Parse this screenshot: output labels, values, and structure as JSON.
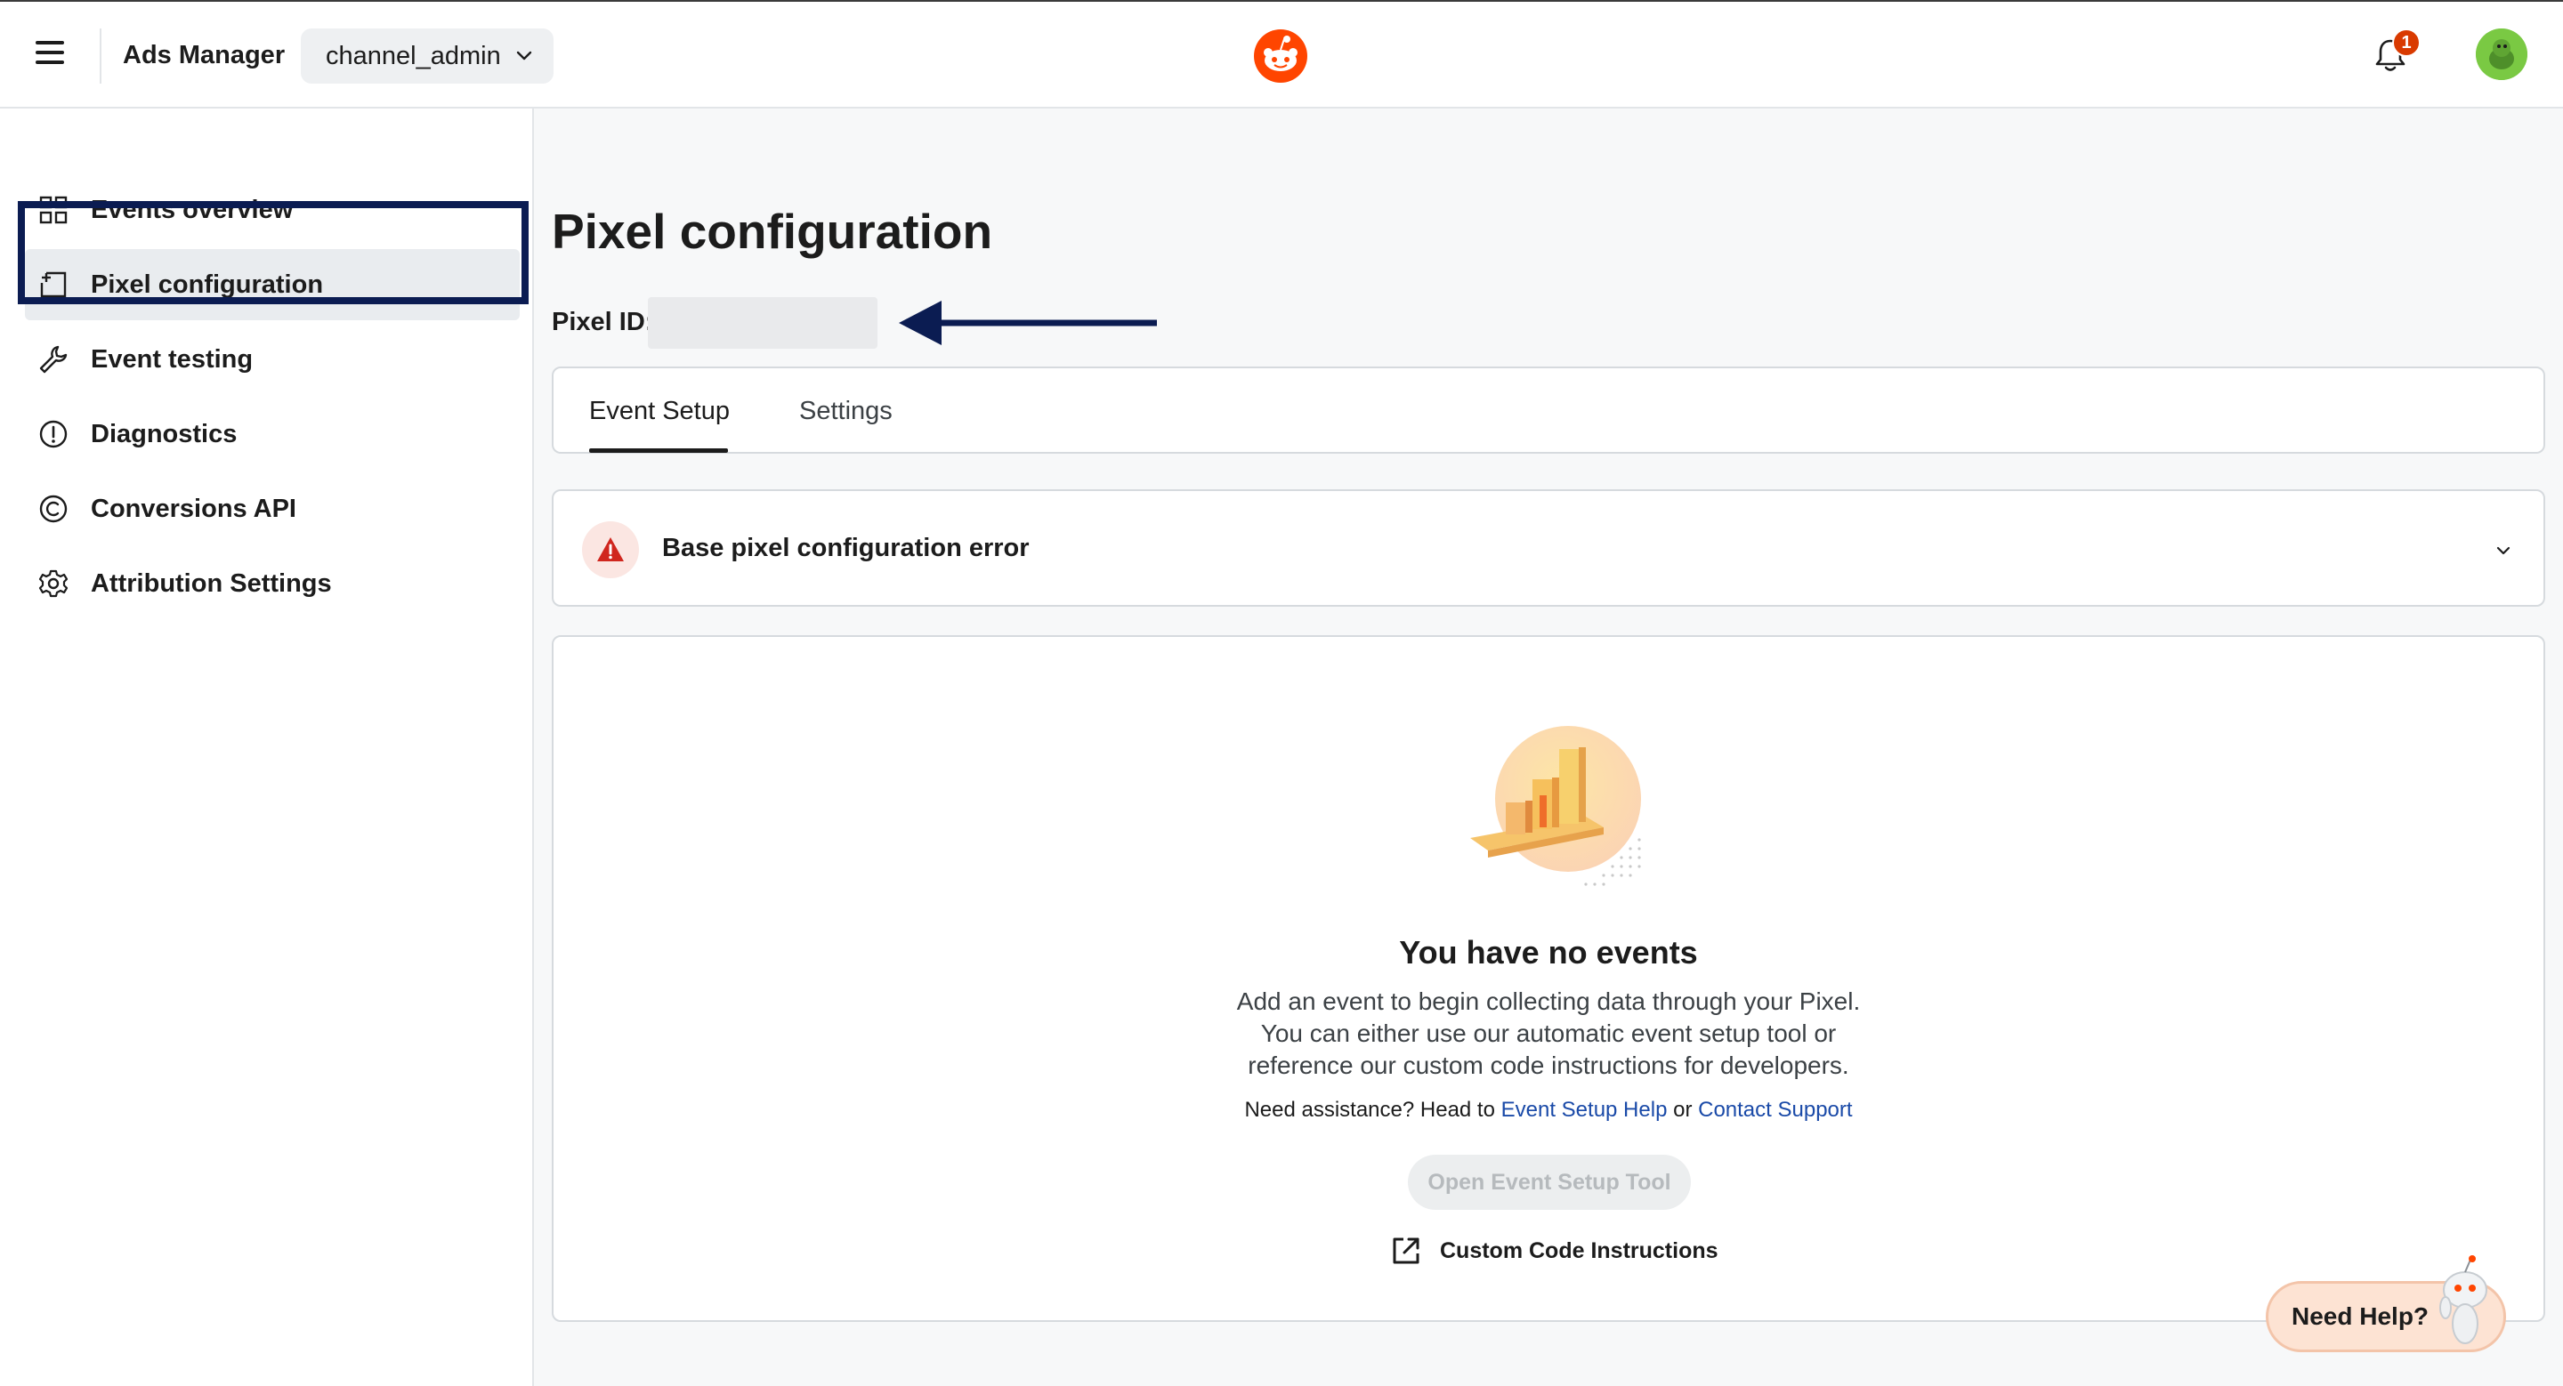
{
  "header": {
    "app_title": "Ads Manager",
    "account_name": "channel_admin",
    "notification_count": "1"
  },
  "sidebar": {
    "items": [
      {
        "label": "Events overview",
        "icon": "grid-icon"
      },
      {
        "label": "Pixel configuration",
        "icon": "pixel-config-icon",
        "active": true
      },
      {
        "label": "Event testing",
        "icon": "wrench-icon"
      },
      {
        "label": "Diagnostics",
        "icon": "alert-circle-icon"
      },
      {
        "label": "Conversions API",
        "icon": "copyright-circle-icon"
      },
      {
        "label": "Attribution Settings",
        "icon": "gear-icon"
      }
    ]
  },
  "main": {
    "title": "Pixel configuration",
    "pixel_id_label": "Pixel ID:",
    "tabs": [
      {
        "label": "Event Setup",
        "selected": true
      },
      {
        "label": "Settings",
        "selected": false
      }
    ],
    "error_banner": {
      "text": "Base pixel configuration error"
    },
    "empty_state": {
      "title": "You have no events",
      "desc_line1": "Add an event to begin collecting data through your Pixel.",
      "desc_line2": "You can either use our automatic event setup tool or",
      "desc_line3": "reference our custom code instructions for developers.",
      "assist_prefix": "Need assistance? Head to ",
      "assist_link1": "Event Setup Help",
      "assist_mid": " or ",
      "assist_link2": "Contact Support",
      "setup_button": "Open Event Setup Tool",
      "custom_code_link": "Custom Code Instructions"
    }
  },
  "help": {
    "label": "Need Help?"
  },
  "colors": {
    "accent": "#ff4500",
    "highlight_box": "#0b1c52",
    "link": "#1a4aa8",
    "error": "#d93a00"
  }
}
